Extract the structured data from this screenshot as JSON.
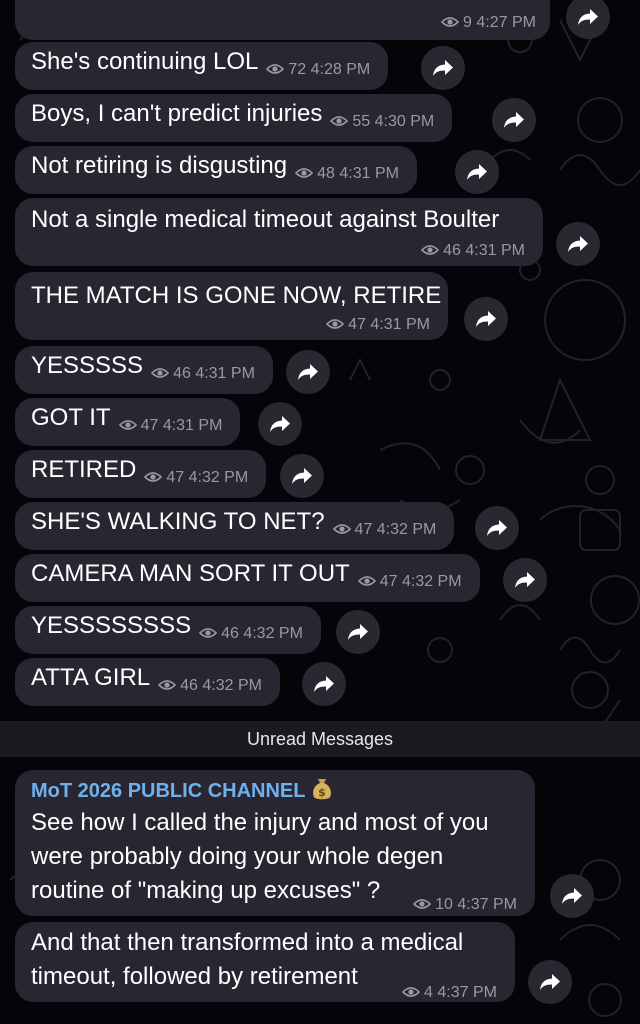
{
  "top_partial": {
    "meta": {
      "views": "9",
      "time": "4:27 PM"
    }
  },
  "messages": [
    {
      "text": "She's continuing LOL",
      "views": "72",
      "time": "4:28 PM"
    },
    {
      "text": "Boys, I can't predict injuries",
      "views": "55",
      "time": "4:30 PM"
    },
    {
      "text": "Not retiring is disgusting",
      "views": "48",
      "time": "4:31 PM"
    },
    {
      "text": "Not a single medical timeout against Boulter",
      "views": "46",
      "time": "4:31 PM"
    },
    {
      "text": "THE MATCH IS GONE NOW, RETIRE",
      "views": "47",
      "time": "4:31 PM"
    },
    {
      "text": "YESSSSS",
      "views": "46",
      "time": "4:31 PM"
    },
    {
      "text": "GOT IT",
      "views": "47",
      "time": "4:31 PM"
    },
    {
      "text": "RETIRED",
      "views": "47",
      "time": "4:32 PM"
    },
    {
      "text": "SHE'S WALKING TO NET?",
      "views": "47",
      "time": "4:32 PM"
    },
    {
      "text": "CAMERA MAN SORT IT OUT",
      "views": "47",
      "time": "4:32 PM"
    },
    {
      "text": "YESSSSSSSS",
      "views": "46",
      "time": "4:32 PM"
    },
    {
      "text": "ATTA GIRL",
      "views": "46",
      "time": "4:32 PM"
    }
  ],
  "unread_divider": "Unread Messages",
  "unread_messages": [
    {
      "sender": "MoT 2026 PUBLIC CHANNEL",
      "sender_icon": "moneybag-icon",
      "lines": [
        "See how I called the injury and most of you",
        "were probably doing your whole degen",
        "routine of \"making up excuses\" ?"
      ],
      "views": "10",
      "time": "4:37 PM"
    },
    {
      "lines": [
        "And that then transformed into a medical",
        "timeout, followed by retirement"
      ],
      "views": "4",
      "time": "4:37 PM"
    }
  ],
  "icons": {
    "views": "eye-icon",
    "share": "share-arrow-icon"
  },
  "colors": {
    "background": "#060409",
    "bubble": "#292631",
    "meta": "#9c98a3",
    "sender": "#6fb1ec",
    "divider_bar": "#1c1a21"
  }
}
